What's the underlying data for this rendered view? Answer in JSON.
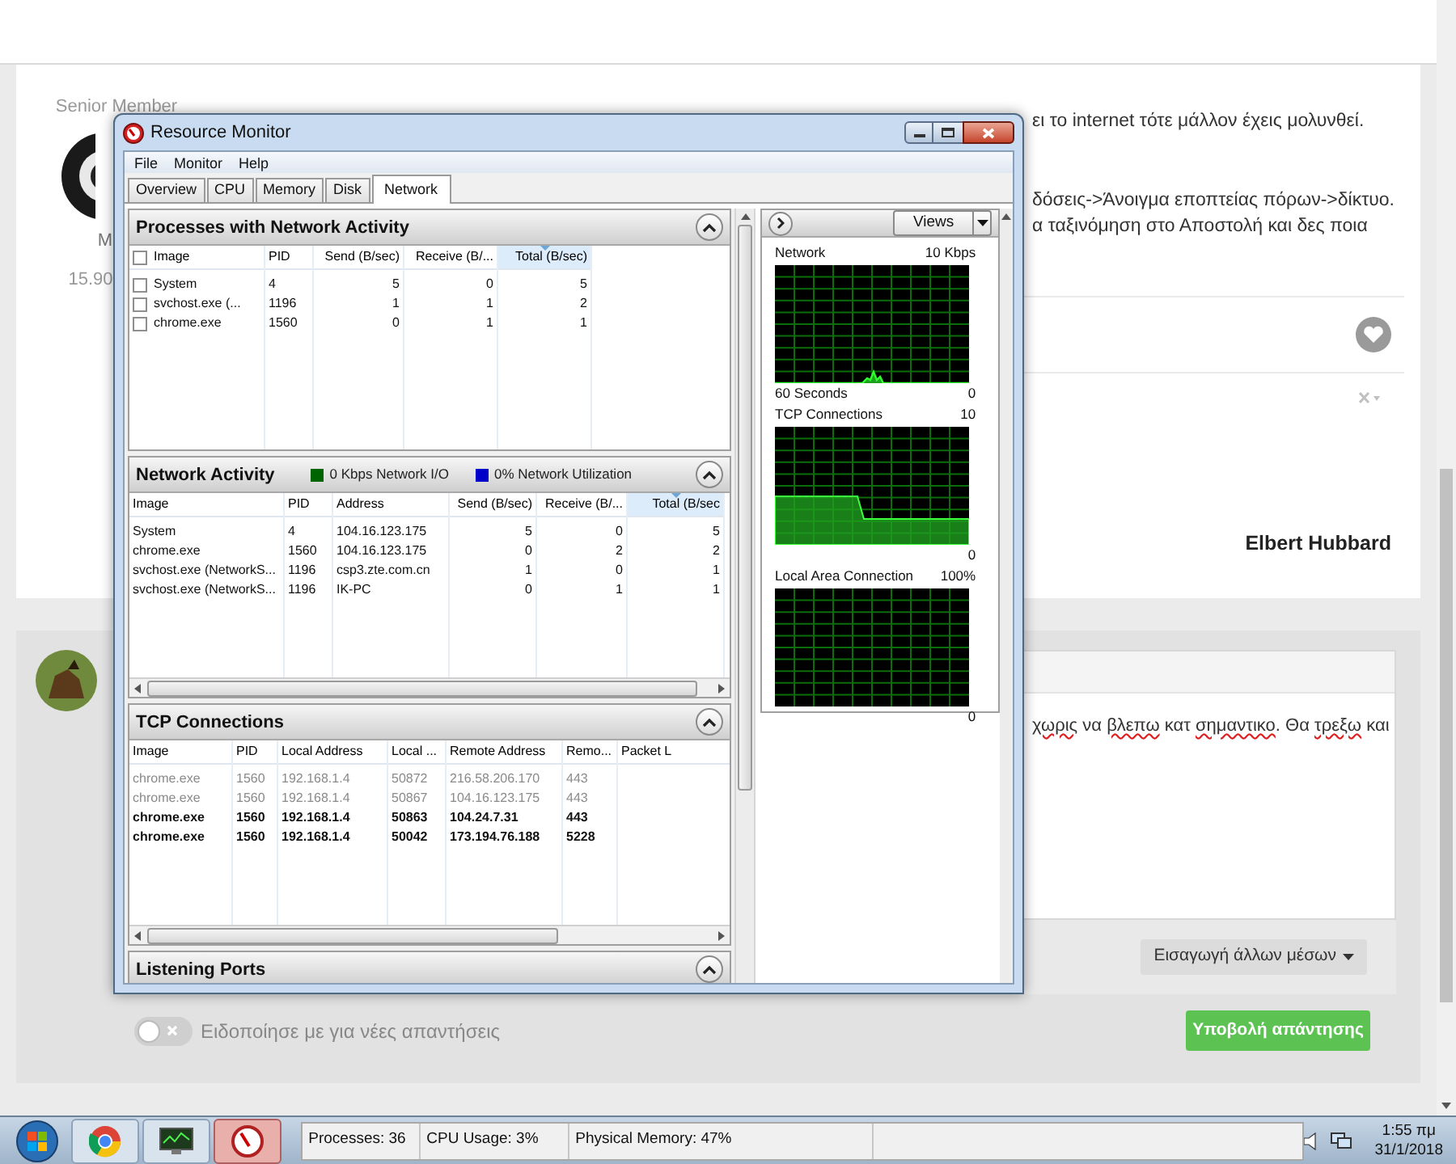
{
  "forum": {
    "author_rank": "Senior Member",
    "author_name_fragment": "M",
    "post_date_fragment": "15.90",
    "post_lines": [
      "ει το internet τότε μάλλον έχεις μολυνθεί.",
      "δόσεις->Άνοιγμα εποπτείας πόρων->δίκτυο.",
      "α ταξινόμηση στο Αποστολή και δες ποια"
    ],
    "signature": "Elbert Hubbard",
    "reply": {
      "editor_segments": [
        {
          "text": "χωρις",
          "misspelled": true
        },
        {
          "text": " να ",
          "misspelled": false
        },
        {
          "text": "βλεπω",
          "misspelled": true
        },
        {
          "text": " κατ ",
          "misspelled": false
        },
        {
          "text": "σημαντικο",
          "misspelled": true
        },
        {
          "text": ". Θα ",
          "misspelled": false
        },
        {
          "text": "τρεξω",
          "misspelled": true
        },
        {
          "text": " και",
          "misspelled": false
        }
      ],
      "insert_media_button": "Εισαγωγή άλλων μέσων",
      "notify": {
        "label": "Ειδοποίησε με για νέες απαντήσεις",
        "on": false
      },
      "submit_button": "Υποβολή απάντησης"
    }
  },
  "resource_monitor": {
    "title": "Resource Monitor",
    "menu": [
      "File",
      "Monitor",
      "Help"
    ],
    "tabs": [
      {
        "label": "Overview",
        "selected": false
      },
      {
        "label": "CPU",
        "selected": false
      },
      {
        "label": "Memory",
        "selected": false
      },
      {
        "label": "Disk",
        "selected": false
      },
      {
        "label": "Network",
        "selected": true
      }
    ],
    "sections": [
      {
        "title": "Processes with Network Activity",
        "expanded": true,
        "select_all": {
          "checked": false
        },
        "columns": [
          {
            "label": "Image",
            "sorted": false
          },
          {
            "label": "PID",
            "sorted": false
          },
          {
            "label": "Send (B/sec)",
            "sorted": false
          },
          {
            "label": "Receive (B/...",
            "sorted": false
          },
          {
            "label": "Total (B/sec)",
            "sorted": true
          }
        ],
        "rows": [
          {
            "checked": false,
            "dimmed": false,
            "cells": [
              "System",
              "4",
              "5",
              "0",
              "5"
            ]
          },
          {
            "checked": false,
            "dimmed": false,
            "cells": [
              "svchost.exe (...",
              "1196",
              "1",
              "1",
              "2"
            ]
          },
          {
            "checked": false,
            "dimmed": false,
            "cells": [
              "chrome.exe",
              "1560",
              "0",
              "1",
              "1"
            ]
          }
        ]
      },
      {
        "title": "Network Activity",
        "expanded": true,
        "legend": [
          {
            "color": "#006400",
            "text": "0 Kbps Network I/O"
          },
          {
            "color": "#0000c8",
            "text": "0% Network Utilization"
          }
        ],
        "columns": [
          {
            "label": "Image",
            "sorted": false
          },
          {
            "label": "PID",
            "sorted": false
          },
          {
            "label": "Address",
            "sorted": false
          },
          {
            "label": "Send (B/sec)",
            "sorted": false
          },
          {
            "label": "Receive (B/...",
            "sorted": false
          },
          {
            "label": "Total (B/sec",
            "sorted": true
          }
        ],
        "rows": [
          {
            "dimmed": false,
            "cells": [
              "System",
              "4",
              "104.16.123.175",
              "5",
              "0",
              "5"
            ]
          },
          {
            "dimmed": false,
            "cells": [
              "chrome.exe",
              "1560",
              "104.16.123.175",
              "0",
              "2",
              "2"
            ]
          },
          {
            "dimmed": false,
            "cells": [
              "svchost.exe (NetworkS...",
              "1196",
              "csp3.zte.com.cn",
              "1",
              "0",
              "1"
            ]
          },
          {
            "dimmed": false,
            "cells": [
              "svchost.exe (NetworkS...",
              "1196",
              "IK-PC",
              "0",
              "1",
              "1"
            ]
          }
        ]
      },
      {
        "title": "TCP Connections",
        "expanded": true,
        "columns": [
          {
            "label": "Image",
            "sorted": false
          },
          {
            "label": "PID",
            "sorted": false
          },
          {
            "label": "Local Address",
            "sorted": false
          },
          {
            "label": "Local ...",
            "sorted": false
          },
          {
            "label": "Remote Address",
            "sorted": false
          },
          {
            "label": "Remo...",
            "sorted": false
          },
          {
            "label": "Packet L",
            "sorted": false
          }
        ],
        "rows": [
          {
            "dimmed": true,
            "cells": [
              "chrome.exe",
              "1560",
              "192.168.1.4",
              "50872",
              "216.58.206.170",
              "443"
            ]
          },
          {
            "dimmed": true,
            "cells": [
              "chrome.exe",
              "1560",
              "192.168.1.4",
              "50867",
              "104.16.123.175",
              "443"
            ]
          },
          {
            "dimmed": false,
            "cells": [
              "chrome.exe",
              "1560",
              "192.168.1.4",
              "50863",
              "104.24.7.31",
              "443"
            ]
          },
          {
            "dimmed": false,
            "cells": [
              "chrome.exe",
              "1560",
              "192.168.1.4",
              "50042",
              "173.194.76.188",
              "5228"
            ]
          }
        ]
      },
      {
        "title": "Listening Ports",
        "expanded": true
      }
    ],
    "views_button": "Views",
    "graphs": [
      {
        "kind": "spike",
        "title": "Network",
        "max": "10 Kbps",
        "time_label": "60 Seconds",
        "min": "0"
      },
      {
        "kind": "step",
        "title": "TCP Connections",
        "max": "10",
        "min": "0"
      },
      {
        "kind": "flat",
        "title": "Local Area Connection",
        "max": "100%",
        "min": "0"
      }
    ]
  },
  "status_bar": [
    "Processes: 36",
    "CPU Usage: 3%",
    "Physical Memory: 47%"
  ],
  "taskbar": {
    "items": [
      {
        "kind": "browser",
        "selected": false
      },
      {
        "kind": "monitor",
        "selected": false
      },
      {
        "kind": "gauge",
        "selected": true
      }
    ],
    "clock": {
      "time": "1:55 πμ",
      "date": "31/1/2018"
    }
  }
}
